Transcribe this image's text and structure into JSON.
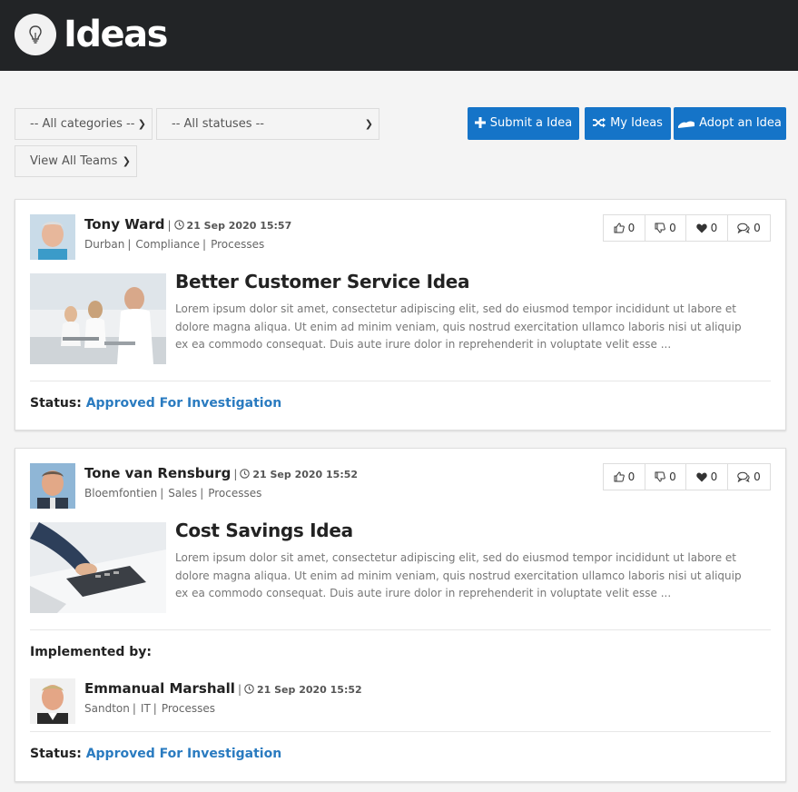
{
  "app": {
    "title": "Ideas",
    "logo_icon": "lightbulb-icon"
  },
  "filters": {
    "categories": "-- All categories --",
    "statuses": "-- All statuses --",
    "teams": "View All Teams"
  },
  "actions": {
    "submit": "Submit a Idea",
    "my_ideas": "My Ideas",
    "adopt": "Adopt an Idea"
  },
  "colors": {
    "accent": "#1574c8",
    "status": "#2a7bc0",
    "header": "#222426"
  },
  "ideas": [
    {
      "author": "Tony Ward",
      "timestamp": "21 Sep 2020 15:57",
      "location": "Durban",
      "department": "Compliance",
      "category": "Processes",
      "votes": {
        "up": "0",
        "down": "0",
        "likes": "0",
        "comments": "0"
      },
      "title": "Better Customer Service Idea",
      "description": "Lorem ipsum dolor sit amet, consectetur adipiscing elit, sed do eiusmod tempor incididunt ut labore et dolore magna aliqua. Ut enim ad minim veniam, quis nostrud exercitation ullamco laboris nisi ut aliquip ex ea commodo consequat. Duis aute irure dolor in reprehenderit in voluptate velit esse ...",
      "status_label": "Status:",
      "status": "Approved For Investigation"
    },
    {
      "author": "Tone van Rensburg",
      "timestamp": "21 Sep 2020 15:52",
      "location": "Bloemfontien",
      "department": "Sales",
      "category": "Processes",
      "votes": {
        "up": "0",
        "down": "0",
        "likes": "0",
        "comments": "0"
      },
      "title": "Cost Savings Idea",
      "description": "Lorem ipsum dolor sit amet, consectetur adipiscing elit, sed do eiusmod tempor incididunt ut labore et dolore magna aliqua. Ut enim ad minim veniam, quis nostrud exercitation ullamco laboris nisi ut aliquip ex ea commodo consequat. Duis aute irure dolor in reprehenderit in voluptate velit esse ...",
      "implemented_label": "Implemented by:",
      "implementer": {
        "name": "Emmanual Marshall",
        "timestamp": "21 Sep 2020 15:52",
        "location": "Sandton",
        "department": "IT",
        "category": "Processes"
      },
      "status_label": "Status:",
      "status": "Approved For Investigation"
    }
  ]
}
